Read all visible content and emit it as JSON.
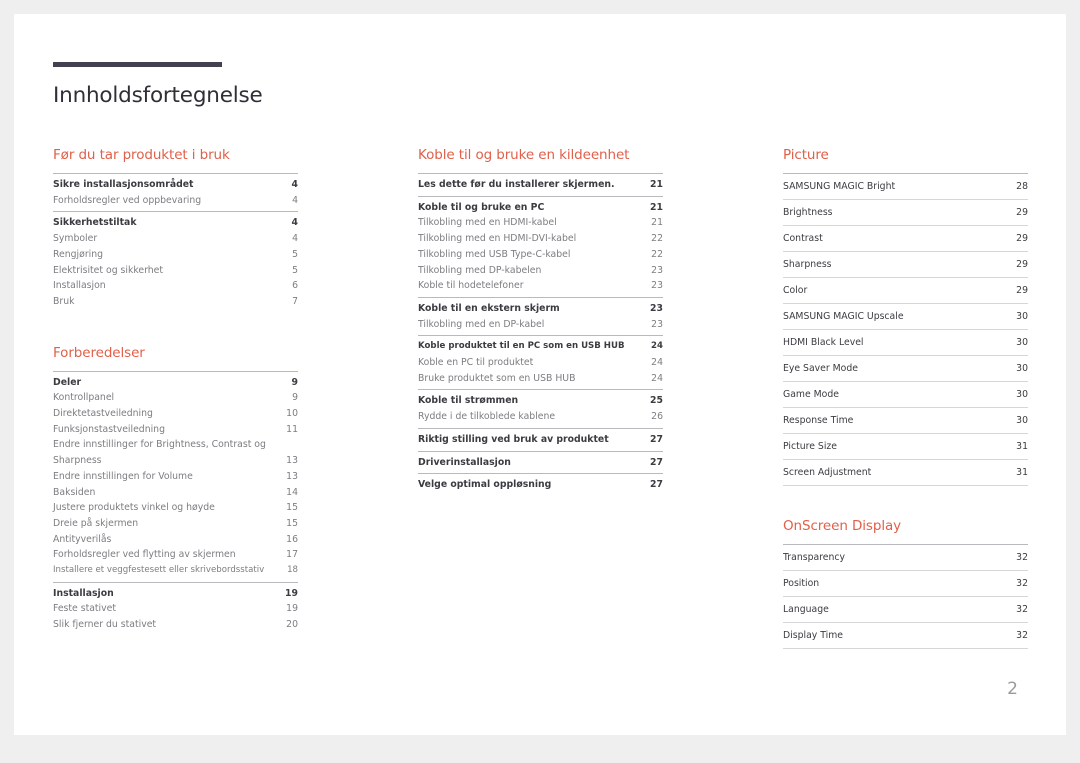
{
  "document": {
    "title": "Innholdsfortegnelse",
    "folio": "2",
    "accent_color": "#e0604a",
    "rule_color": "#434150"
  },
  "columns": {
    "left": [
      {
        "heading": "Før du tar produktet i bruk",
        "groups": [
          {
            "entries": [
              {
                "label": "Sikre installasjonsområdet",
                "page": "4",
                "level": "top"
              },
              {
                "label": "Forholdsregler ved oppbevaring",
                "page": "4",
                "level": "sub"
              }
            ]
          },
          {
            "entries": [
              {
                "label": "Sikkerhetstiltak",
                "page": "4",
                "level": "top"
              },
              {
                "label": "Symboler",
                "page": "4",
                "level": "sub"
              },
              {
                "label": "Rengjøring",
                "page": "5",
                "level": "sub"
              },
              {
                "label": "Elektrisitet og sikkerhet",
                "page": "5",
                "level": "sub"
              },
              {
                "label": "Installasjon",
                "page": "6",
                "level": "sub"
              },
              {
                "label": "Bruk",
                "page": "7",
                "level": "sub"
              }
            ]
          }
        ]
      },
      {
        "heading": "Forberedelser",
        "groups": [
          {
            "entries": [
              {
                "label": "Deler",
                "page": "9",
                "level": "top"
              },
              {
                "label": "Kontrollpanel",
                "page": "9",
                "level": "sub"
              },
              {
                "label": "Direktetastveiledning",
                "page": "10",
                "level": "sub"
              },
              {
                "label": "Funksjonstastveiledning",
                "page": "11",
                "level": "sub"
              },
              {
                "label": "Endre innstillinger for Brightness, Contrast og Sharpness",
                "page": "13",
                "level": "sub",
                "wrapped": true
              },
              {
                "label": "Endre innstillingen for Volume",
                "page": "13",
                "level": "sub"
              },
              {
                "label": "Baksiden",
                "page": "14",
                "level": "sub"
              },
              {
                "label": "Justere produktets vinkel og høyde",
                "page": "15",
                "level": "sub"
              },
              {
                "label": "Dreie på skjermen",
                "page": "15",
                "level": "sub"
              },
              {
                "label": "Antityverilås",
                "page": "16",
                "level": "sub"
              },
              {
                "label": "Forholdsregler ved flytting av skjermen",
                "page": "17",
                "level": "sub"
              },
              {
                "label": "Installere et veggfestesett eller skrivebordsstativ",
                "page": "18",
                "level": "sub",
                "tight": true
              }
            ]
          },
          {
            "entries": [
              {
                "label": "Installasjon",
                "page": "19",
                "level": "top"
              },
              {
                "label": "Feste stativet",
                "page": "19",
                "level": "sub"
              },
              {
                "label": "Slik fjerner du stativet",
                "page": "20",
                "level": "sub"
              }
            ]
          }
        ]
      }
    ],
    "middle": [
      {
        "heading": "Koble til og bruke en kildeenhet",
        "groups": [
          {
            "entries": [
              {
                "label": "Les dette før du installerer skjermen.",
                "page": "21",
                "level": "top"
              }
            ]
          },
          {
            "entries": [
              {
                "label": "Koble til og bruke en PC",
                "page": "21",
                "level": "top"
              },
              {
                "label": "Tilkobling med en HDMI-kabel",
                "page": "21",
                "level": "sub"
              },
              {
                "label": "Tilkobling med en HDMI-DVI-kabel",
                "page": "22",
                "level": "sub"
              },
              {
                "label": "Tilkobling med USB Type-C-kabel",
                "page": "22",
                "level": "sub"
              },
              {
                "label": "Tilkobling med DP-kabelen",
                "page": "23",
                "level": "sub"
              },
              {
                "label": "Koble til hodetelefoner",
                "page": "23",
                "level": "sub"
              }
            ]
          },
          {
            "entries": [
              {
                "label": "Koble til en ekstern skjerm",
                "page": "23",
                "level": "top"
              },
              {
                "label": "Tilkobling med en DP-kabel",
                "page": "23",
                "level": "sub"
              }
            ]
          },
          {
            "entries": [
              {
                "label": "Koble produktet til en PC som en USB HUB",
                "page": "24",
                "level": "top",
                "tight": true
              },
              {
                "label": "Koble en PC til produktet",
                "page": "24",
                "level": "sub"
              },
              {
                "label": "Bruke produktet som en USB HUB",
                "page": "24",
                "level": "sub"
              }
            ]
          },
          {
            "entries": [
              {
                "label": "Koble til strømmen",
                "page": "25",
                "level": "top"
              },
              {
                "label": "Rydde i de tilkoblede kablene",
                "page": "26",
                "level": "sub"
              }
            ]
          },
          {
            "entries": [
              {
                "label": "Riktig stilling ved bruk av produktet",
                "page": "27",
                "level": "top"
              }
            ]
          },
          {
            "entries": [
              {
                "label": "Driverinstallasjon",
                "page": "27",
                "level": "top"
              }
            ]
          },
          {
            "entries": [
              {
                "label": "Velge optimal oppløsning",
                "page": "27",
                "level": "top"
              }
            ]
          }
        ]
      }
    ],
    "right": [
      {
        "heading": "Picture",
        "rows": [
          {
            "label": "SAMSUNG MAGIC Bright",
            "page": "28"
          },
          {
            "label": "Brightness",
            "page": "29"
          },
          {
            "label": "Contrast",
            "page": "29"
          },
          {
            "label": "Sharpness",
            "page": "29"
          },
          {
            "label": "Color",
            "page": "29"
          },
          {
            "label": "SAMSUNG MAGIC Upscale",
            "page": "30"
          },
          {
            "label": "HDMI Black Level",
            "page": "30"
          },
          {
            "label": "Eye Saver Mode",
            "page": "30"
          },
          {
            "label": "Game Mode",
            "page": "30"
          },
          {
            "label": "Response Time",
            "page": "30"
          },
          {
            "label": "Picture Size",
            "page": "31"
          },
          {
            "label": "Screen Adjustment",
            "page": "31"
          }
        ]
      },
      {
        "heading": "OnScreen Display",
        "rows": [
          {
            "label": "Transparency",
            "page": "32"
          },
          {
            "label": "Position",
            "page": "32"
          },
          {
            "label": "Language",
            "page": "32"
          },
          {
            "label": "Display Time",
            "page": "32"
          }
        ]
      }
    ]
  }
}
